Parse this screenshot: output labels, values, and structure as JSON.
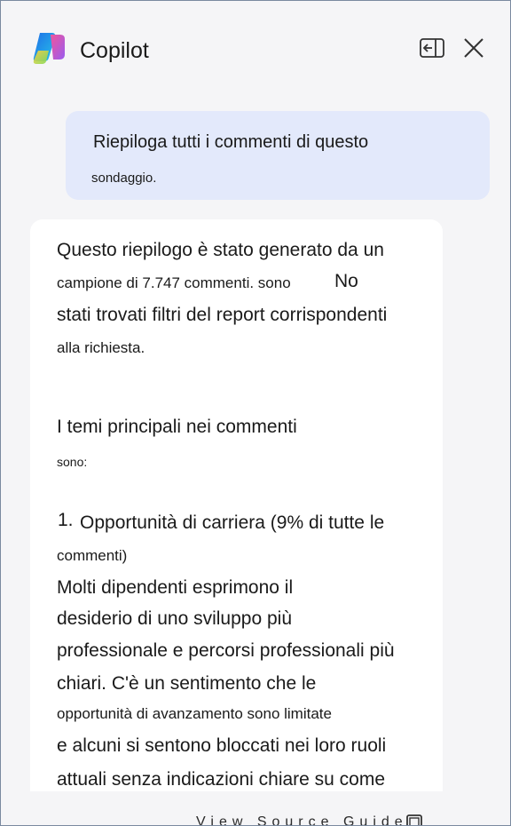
{
  "header": {
    "title": "Copilot",
    "logo_icon": "copilot-logo-icon",
    "panel_icon": "open-panel-icon",
    "close_icon": "close-icon"
  },
  "user_message": {
    "line1": "Riepiloga tutti i commenti di questo",
    "line2": "sondaggio."
  },
  "response": {
    "p1": {
      "l1": "Questo riepilogo è stato generato da un",
      "l2": "campione di 7.747 commenti. sono",
      "l2b": "No",
      "l3": "stati trovati filtri del report corrispondenti",
      "l4": "alla richiesta."
    },
    "p2": {
      "l1": "I temi principali nei commenti",
      "l2": "sono:"
    },
    "item1": {
      "number": "1.",
      "l1": "Opportunità di carriera (9% di tutte le",
      "l2": "commenti)",
      "l3": "Molti dipendenti esprimono il",
      "l4": "desiderio di uno sviluppo più",
      "l5": "professionale e percorsi professionali più",
      "l6": "chiari. C'è un sentimento che le",
      "l7": "opportunità di avanzamento sono limitate",
      "l8": "e alcuni si sentono bloccati nei loro ruoli",
      "l9": "attuali senza indicazioni chiare su come"
    }
  },
  "footer": {
    "partial_text": "View Source Guide",
    "icon": "copy-icon"
  },
  "colors": {
    "panel_bg": "#f5f5f7",
    "user_bubble_bg": "#e3e9fb",
    "card_bg": "#ffffff",
    "frame_border": "#7a8aa0"
  }
}
